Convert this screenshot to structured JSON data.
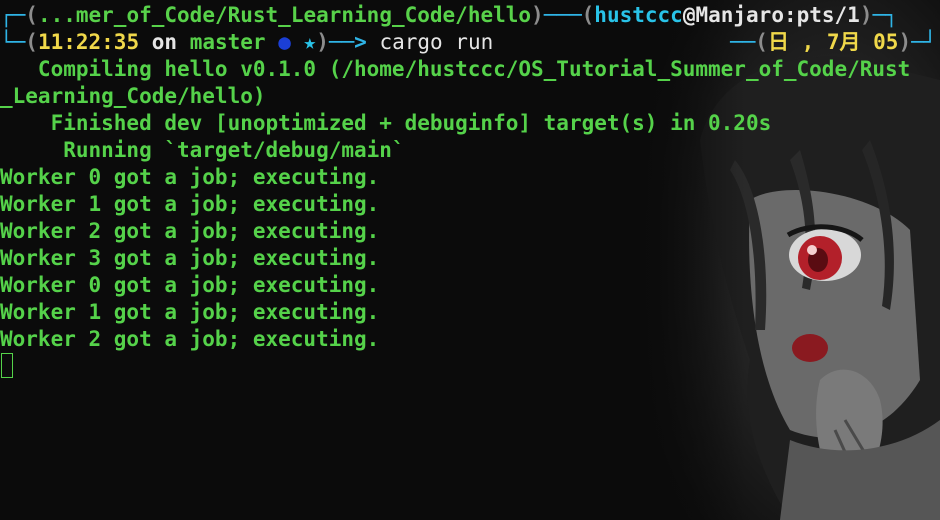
{
  "prompt": {
    "path": "...mer_of_Code/Rust_Learning_Code/hello",
    "user": "hustccc",
    "host": "Manjaro:pts/1",
    "time": "11:22:35",
    "on_word": "on",
    "branch": "master",
    "status_dot": "●",
    "status_star": "★",
    "arrow": "──> ",
    "command": "cargo run",
    "date": "日 , 7月 05"
  },
  "output": {
    "compiling": "   Compiling hello v0.1.0 (/home/hustccc/OS_Tutorial_Summer_of_Code/Rust",
    "compiling_cont": "_Learning_Code/hello)",
    "finished": "    Finished dev [unoptimized + debuginfo] target(s) in 0.20s",
    "running": "     Running `target/debug/main`",
    "workers": [
      "Worker 0 got a job; executing.",
      "Worker 1 got a job; executing.",
      "Worker 2 got a job; executing.",
      "Worker 3 got a job; executing.",
      "Worker 0 got a job; executing.",
      "Worker 1 got a job; executing.",
      "Worker 2 got a job; executing."
    ]
  },
  "colors": {
    "background": "#0b0b0b",
    "output_green": "#55d24a",
    "frame_blue": "#2fb4e6",
    "time_yellow": "#f0d84a"
  }
}
